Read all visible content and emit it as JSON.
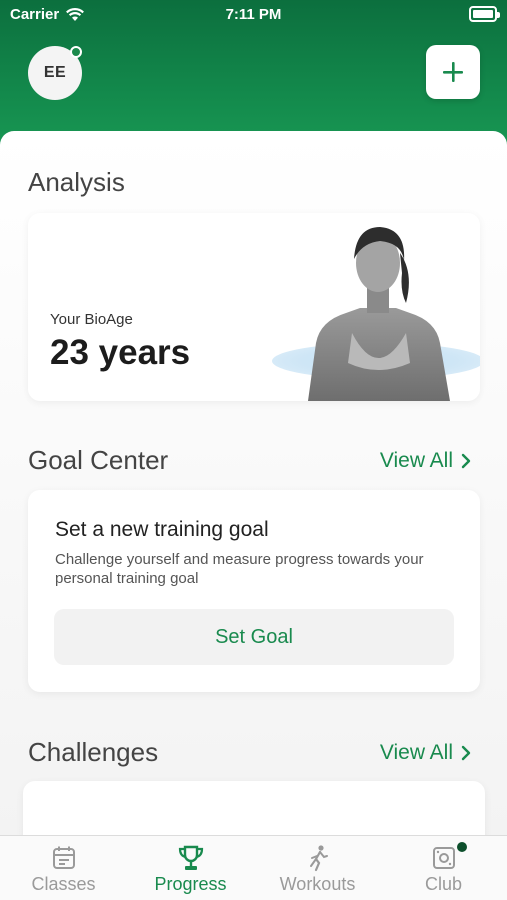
{
  "status_bar": {
    "carrier": "Carrier",
    "time": "7:11 PM"
  },
  "header": {
    "avatar_initials": "EE"
  },
  "analysis": {
    "title": "Analysis",
    "bioage_label": "Your BioAge",
    "bioage_value": "23 years"
  },
  "goal_center": {
    "title": "Goal Center",
    "view_all": "View All",
    "card_heading": "Set a new training goal",
    "card_description": "Challenge yourself and measure progress towards your personal training goal",
    "button_label": "Set Goal"
  },
  "challenges": {
    "title": "Challenges",
    "view_all": "View All"
  },
  "tab_bar": {
    "items": [
      {
        "label": "Classes",
        "icon": "calendar-icon",
        "active": false
      },
      {
        "label": "Progress",
        "icon": "trophy-icon",
        "active": true
      },
      {
        "label": "Workouts",
        "icon": "runner-icon",
        "active": false
      },
      {
        "label": "Club",
        "icon": "club-icon",
        "active": false,
        "badge": true
      }
    ]
  },
  "colors": {
    "brand_green": "#198a4e",
    "header_green": "#0c6f3e"
  }
}
